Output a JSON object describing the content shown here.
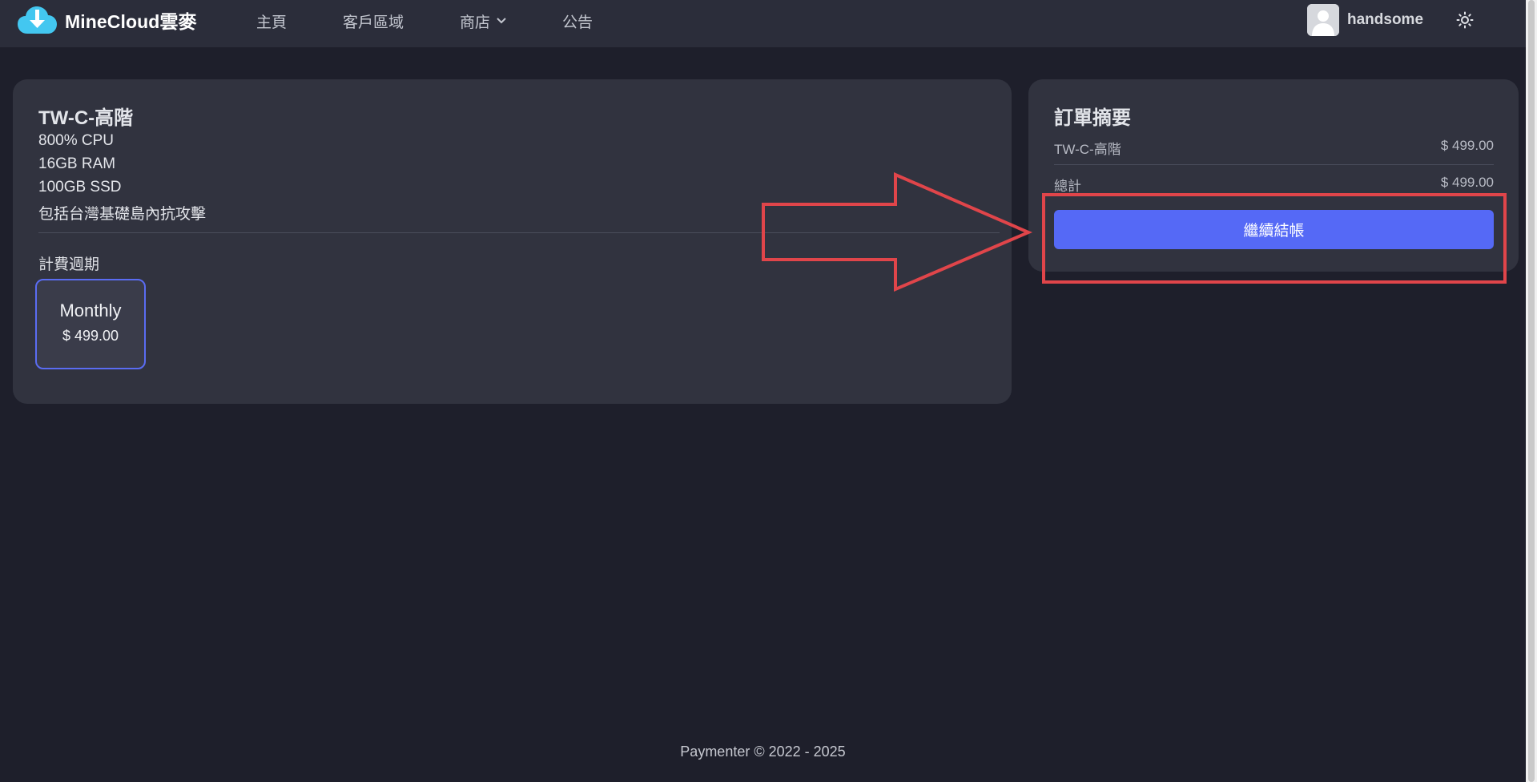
{
  "brand": {
    "name": "MineCloud雲麥"
  },
  "nav": {
    "items": [
      {
        "label": "主頁"
      },
      {
        "label": "客戶區域"
      },
      {
        "label": "商店"
      },
      {
        "label": "公告"
      }
    ]
  },
  "user": {
    "name": "handsome"
  },
  "product": {
    "title": "TW-C-高階",
    "specs": [
      "800% CPU",
      "16GB RAM",
      "100GB SSD",
      "包括台灣基礎島內抗攻擊"
    ],
    "billing_label": "計費週期",
    "period": {
      "name": "Monthly",
      "price": "$ 499.00",
      "selected": true
    }
  },
  "summary": {
    "title": "訂單摘要",
    "item_name": "TW-C-高階",
    "item_price": "$ 499.00",
    "total_label": "總計",
    "total_price": "$ 499.00",
    "checkout_label": "繼續結帳"
  },
  "footer": {
    "text": "Paymenter © 2022 - 2025"
  },
  "colors": {
    "accent": "#5569f6",
    "annotation": "#e0454a",
    "background": "#1e1f2b",
    "card": "#31333f"
  }
}
